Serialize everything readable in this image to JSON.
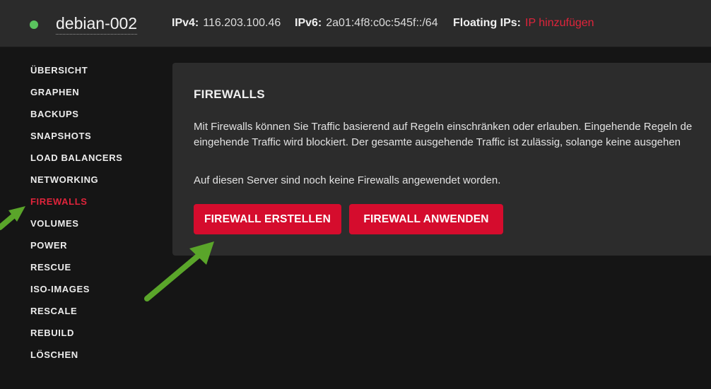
{
  "header": {
    "server_name": "debian-002",
    "ipv4_label": "IPv4:",
    "ipv4_value": "116.203.100.46",
    "ipv6_label": "IPv6:",
    "ipv6_value": "2a01:4f8:c0c:545f::/64",
    "floating_label": "Floating IPs:",
    "floating_link": "IP hinzufügen",
    "status_color": "#5ac45e"
  },
  "sidebar": {
    "items": [
      {
        "label": "ÜBERSICHT"
      },
      {
        "label": "GRAPHEN"
      },
      {
        "label": "BACKUPS"
      },
      {
        "label": "SNAPSHOTS"
      },
      {
        "label": "LOAD BALANCERS"
      },
      {
        "label": "NETWORKING"
      },
      {
        "label": "FIREWALLS",
        "active": true
      },
      {
        "label": "VOLUMES"
      },
      {
        "label": "POWER"
      },
      {
        "label": "RESCUE"
      },
      {
        "label": "ISO-IMAGES"
      },
      {
        "label": "RESCALE"
      },
      {
        "label": "REBUILD"
      },
      {
        "label": "LÖSCHEN"
      }
    ]
  },
  "panel": {
    "title": "FIREWALLS",
    "desc_line1": "Mit Firewalls können Sie Traffic basierend auf Regeln einschränken oder erlauben. Eingehende Regeln de",
    "desc_line2": "eingehende Traffic wird blockiert. Der gesamte ausgehende Traffic ist zulässig, solange keine ausgehen",
    "empty_text": "Auf diesen Server sind noch keine Firewalls angewendet worden.",
    "create_button": "FIREWALL ERSTELLEN",
    "apply_button": "FIREWALL ANWENDEN"
  },
  "colors": {
    "accent": "#e0243b",
    "button": "#d50c2d",
    "annotation_arrow": "#5aa52a"
  }
}
